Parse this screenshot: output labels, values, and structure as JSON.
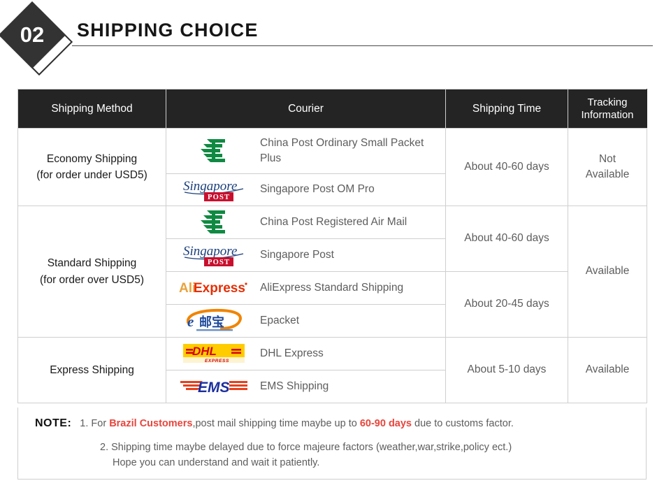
{
  "header": {
    "badge_number": "02",
    "title": "SHIPPING CHOICE"
  },
  "table": {
    "columns": {
      "method": "Shipping Method",
      "courier": "Courier",
      "time": "Shipping Time",
      "tracking_line1": "Tracking",
      "tracking_line2": "Information"
    },
    "groups": [
      {
        "method_line1": "Economy Shipping",
        "method_line2": "(for order under USD5)",
        "tracking": "Not\nAvailable",
        "tracking_line1": "Not",
        "tracking_line2": "Available",
        "rows": [
          {
            "logo": "china-post-logo",
            "courier": "China Post Ordinary Small Packet Plus",
            "time": "About 40-60 days"
          },
          {
            "logo": "singapore-post-logo",
            "courier": "Singapore Post OM Pro"
          }
        ]
      },
      {
        "method_line1": "Standard Shipping",
        "method_line2": "(for order over USD5)",
        "tracking_line1": "Available",
        "tracking_line2": "",
        "rows": [
          {
            "logo": "china-post-logo",
            "courier": "China Post Registered Air Mail",
            "time": "About 40-60 days"
          },
          {
            "logo": "singapore-post-logo",
            "courier": "Singapore Post"
          },
          {
            "logo": "aliexpress-logo",
            "courier": "AliExpress Standard Shipping",
            "time": "About 20-45 days"
          },
          {
            "logo": "epacket-logo",
            "courier": "Epacket"
          }
        ]
      },
      {
        "method_line1": "Express Shipping",
        "method_line2": "",
        "tracking_line1": "Available",
        "tracking_line2": "",
        "rows": [
          {
            "logo": "dhl-logo",
            "courier": "DHL Express",
            "time": "About 5-10 days"
          },
          {
            "logo": "ems-logo",
            "courier": "EMS Shipping"
          }
        ]
      }
    ]
  },
  "note": {
    "label": "NOTE:",
    "line1_a": "1. For ",
    "line1_red1": "Brazil Customers",
    "line1_b": ",post mail shipping time maybe up to ",
    "line1_red2": "60-90 days",
    "line1_c": " due to customs factor.",
    "line2": "2. Shipping time maybe delayed due to force majeure factors (weather,war,strike,policy ect.)",
    "line3": "Hope you can understand and wait it patiently."
  },
  "colors": {
    "header_bg": "#242424",
    "china_post_green": "#108a42",
    "singapore_blue": "#1b3f7a",
    "singapore_red": "#c8102e",
    "ali_orange": "#e8a33d",
    "ali_red": "#e62e04",
    "epacket_blue": "#1f4a9b",
    "epacket_orange": "#f08400",
    "dhl_yellow": "#ffcc00",
    "dhl_red": "#d40511",
    "ems_blue": "#1b2f9e",
    "ems_red": "#e8401c",
    "note_red": "#e8453c"
  }
}
